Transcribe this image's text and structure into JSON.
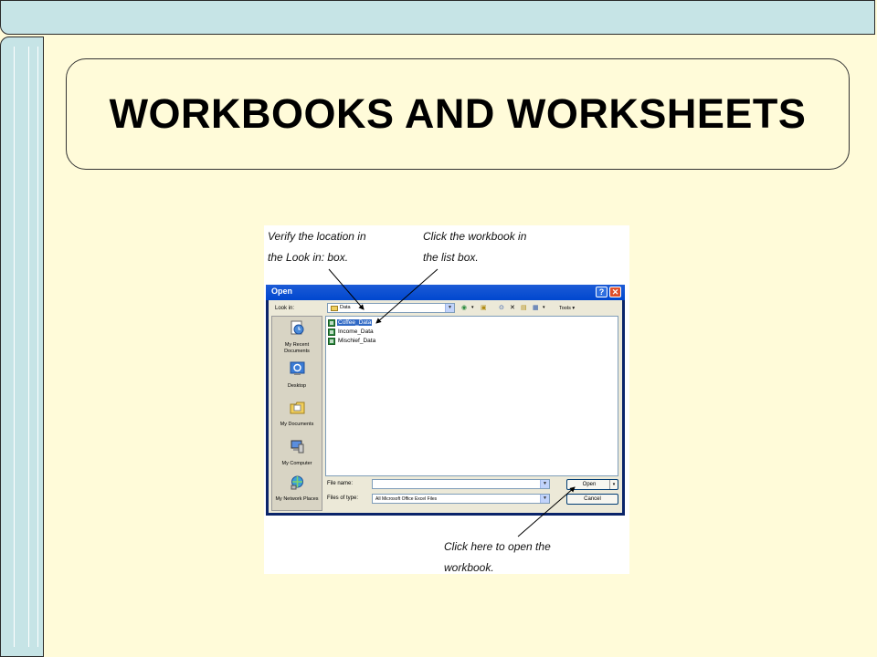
{
  "slide": {
    "title": "WORKBOOKS AND WORKSHEETS"
  },
  "callouts": {
    "look_in": [
      "Verify the location in",
      "the Look in: box."
    ],
    "workbook": [
      "Click the workbook in",
      "the list box."
    ],
    "open": [
      "Click here to open the",
      "workbook."
    ]
  },
  "dialog": {
    "title": "Open",
    "help_label": "?",
    "close_label": "✕",
    "look_in_label": "Look in:",
    "look_in_value": "Data",
    "tools_label": "Tools",
    "places": [
      {
        "label": "My Recent Documents",
        "icon": "recent-documents-icon"
      },
      {
        "label": "Desktop",
        "icon": "desktop-icon"
      },
      {
        "label": "My Documents",
        "icon": "my-documents-icon"
      },
      {
        "label": "My Computer",
        "icon": "my-computer-icon"
      },
      {
        "label": "My Network Places",
        "icon": "network-places-icon"
      }
    ],
    "files": [
      {
        "name": "Coffee_Data",
        "selected": true
      },
      {
        "name": "Income_Data",
        "selected": false
      },
      {
        "name": "Mischief_Data",
        "selected": false
      }
    ],
    "file_name_label": "File name:",
    "file_name_value": "",
    "file_type_label": "Files of type:",
    "file_type_value": "All Microsoft Office Excel Files",
    "open_button": "Open",
    "cancel_button": "Cancel"
  },
  "colors": {
    "slide_bg": "#fffbd9",
    "frame": "#c6e4e6",
    "titlebar": "#0047cf",
    "selection": "#316ac5"
  }
}
